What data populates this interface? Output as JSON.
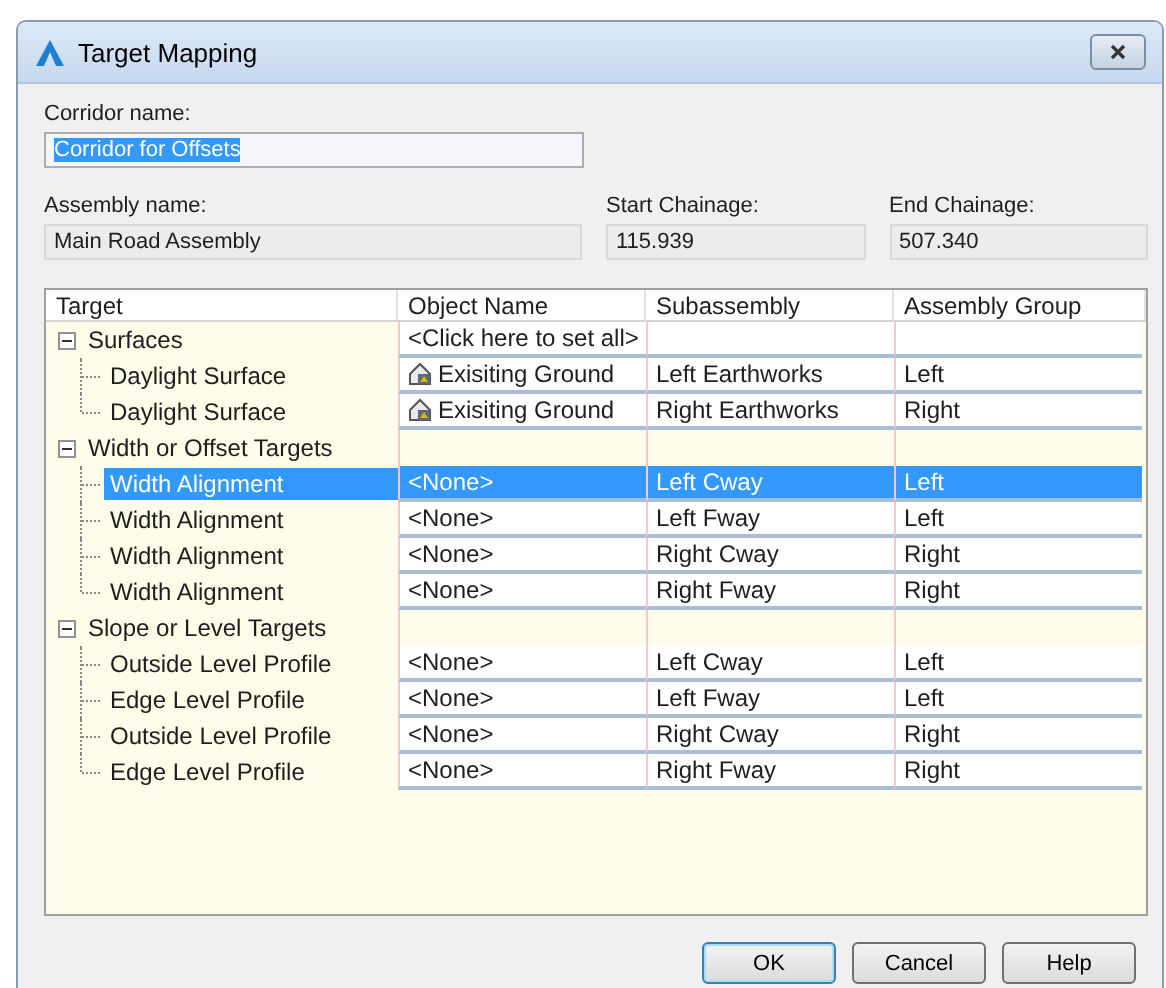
{
  "window": {
    "title": "Target Mapping"
  },
  "corridor": {
    "label": "Corridor name:",
    "value": "Corridor for Offsets",
    "selected": true
  },
  "assembly": {
    "label": "Assembly name:",
    "value": "Main Road Assembly"
  },
  "start_chainage": {
    "label": "Start Chainage:",
    "value": "115.939"
  },
  "end_chainage": {
    "label": "End Chainage:",
    "value": "507.340"
  },
  "table": {
    "columns": [
      "Target",
      "Object Name",
      "Subassembly",
      "Assembly Group"
    ],
    "groups": [
      {
        "label": "Surfaces",
        "expanded": true,
        "object_name": "<Click here to set all>",
        "children": [
          {
            "label": "Daylight Surface",
            "kind": "surface",
            "object_name": "Exisiting Ground",
            "subassembly": "Left Earthworks",
            "assembly_group": "Left",
            "selected": false
          },
          {
            "label": "Daylight Surface",
            "kind": "surface",
            "object_name": "Exisiting Ground",
            "subassembly": "Right Earthworks",
            "assembly_group": "Right",
            "selected": false
          }
        ]
      },
      {
        "label": "Width or Offset Targets",
        "expanded": true,
        "children": [
          {
            "label": "Width Alignment",
            "kind": "plain",
            "object_name": "<None>",
            "subassembly": "Left Cway",
            "assembly_group": "Left",
            "selected": true
          },
          {
            "label": "Width Alignment",
            "kind": "plain",
            "object_name": "<None>",
            "subassembly": "Left Fway",
            "assembly_group": "Left",
            "selected": false
          },
          {
            "label": "Width Alignment",
            "kind": "plain",
            "object_name": "<None>",
            "subassembly": "Right Cway",
            "assembly_group": "Right",
            "selected": false
          },
          {
            "label": "Width Alignment",
            "kind": "plain",
            "object_name": "<None>",
            "subassembly": "Right Fway",
            "assembly_group": "Right",
            "selected": false
          }
        ]
      },
      {
        "label": "Slope or Level Targets",
        "expanded": true,
        "children": [
          {
            "label": "Outside Level Profile",
            "kind": "plain",
            "object_name": "<None>",
            "subassembly": "Left Cway",
            "assembly_group": "Left",
            "selected": false
          },
          {
            "label": "Edge Level Profile",
            "kind": "plain",
            "object_name": "<None>",
            "subassembly": "Left Fway",
            "assembly_group": "Left",
            "selected": false
          },
          {
            "label": "Outside Level Profile",
            "kind": "plain",
            "object_name": "<None>",
            "subassembly": "Right Cway",
            "assembly_group": "Right",
            "selected": false
          },
          {
            "label": "Edge Level Profile",
            "kind": "plain",
            "object_name": "<None>",
            "subassembly": "Right Fway",
            "assembly_group": "Right",
            "selected": false
          }
        ]
      }
    ]
  },
  "buttons": [
    {
      "label": "OK",
      "default": true
    },
    {
      "label": "Cancel",
      "default": false
    },
    {
      "label": "Help",
      "default": false
    }
  ]
}
